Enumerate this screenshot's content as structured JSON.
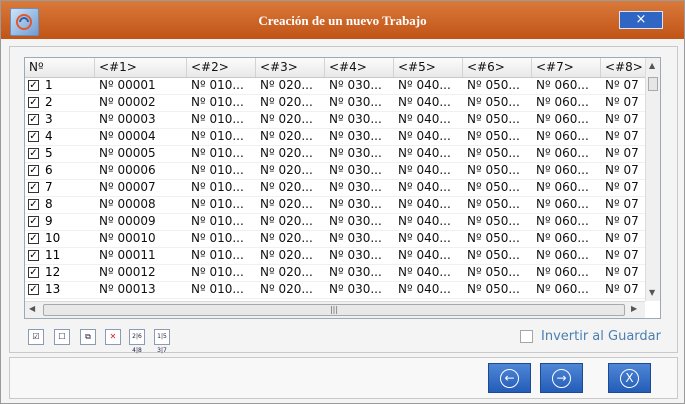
{
  "window": {
    "title": "Creación de un nuevo Trabajo",
    "close_label": "×"
  },
  "grid": {
    "headers": [
      "Nº",
      "<#1>",
      "<#2>",
      "<#3>",
      "<#4>",
      "<#5>",
      "<#6>",
      "<#7>",
      "<#8>"
    ],
    "rows": [
      {
        "n": "1",
        "c": [
          "Nº 00001",
          "Nº 010...",
          "Nº 020...",
          "Nº 030...",
          "Nº 040...",
          "Nº 050...",
          "Nº 060...",
          "Nº 07"
        ]
      },
      {
        "n": "2",
        "c": [
          "Nº 00002",
          "Nº 010...",
          "Nº 020...",
          "Nº 030...",
          "Nº 040...",
          "Nº 050...",
          "Nº 060...",
          "Nº 07"
        ]
      },
      {
        "n": "3",
        "c": [
          "Nº 00003",
          "Nº 010...",
          "Nº 020...",
          "Nº 030...",
          "Nº 040...",
          "Nº 050...",
          "Nº 060...",
          "Nº 07"
        ]
      },
      {
        "n": "4",
        "c": [
          "Nº 00004",
          "Nº 010...",
          "Nº 020...",
          "Nº 030...",
          "Nº 040...",
          "Nº 050...",
          "Nº 060...",
          "Nº 07"
        ]
      },
      {
        "n": "5",
        "c": [
          "Nº 00005",
          "Nº 010...",
          "Nº 020...",
          "Nº 030...",
          "Nº 040...",
          "Nº 050...",
          "Nº 060...",
          "Nº 07"
        ]
      },
      {
        "n": "6",
        "c": [
          "Nº 00006",
          "Nº 010...",
          "Nº 020...",
          "Nº 030...",
          "Nº 040...",
          "Nº 050...",
          "Nº 060...",
          "Nº 07"
        ]
      },
      {
        "n": "7",
        "c": [
          "Nº 00007",
          "Nº 010...",
          "Nº 020...",
          "Nº 030...",
          "Nº 040...",
          "Nº 050...",
          "Nº 060...",
          "Nº 07"
        ]
      },
      {
        "n": "8",
        "c": [
          "Nº 00008",
          "Nº 010...",
          "Nº 020...",
          "Nº 030...",
          "Nº 040...",
          "Nº 050...",
          "Nº 060...",
          "Nº 07"
        ]
      },
      {
        "n": "9",
        "c": [
          "Nº 00009",
          "Nº 010...",
          "Nº 020...",
          "Nº 030...",
          "Nº 040...",
          "Nº 050...",
          "Nº 060...",
          "Nº 07"
        ]
      },
      {
        "n": "10",
        "c": [
          "Nº 00010",
          "Nº 010...",
          "Nº 020...",
          "Nº 030...",
          "Nº 040...",
          "Nº 050...",
          "Nº 060...",
          "Nº 07"
        ]
      },
      {
        "n": "11",
        "c": [
          "Nº 00011",
          "Nº 010...",
          "Nº 020...",
          "Nº 030...",
          "Nº 040...",
          "Nº 050...",
          "Nº 060...",
          "Nº 07"
        ]
      },
      {
        "n": "12",
        "c": [
          "Nº 00012",
          "Nº 010...",
          "Nº 020...",
          "Nº 030...",
          "Nº 040...",
          "Nº 050...",
          "Nº 060...",
          "Nº 07"
        ]
      },
      {
        "n": "13",
        "c": [
          "Nº 00013",
          "Nº 010...",
          "Nº 020...",
          "Nº 030...",
          "Nº 040...",
          "Nº 050...",
          "Nº 060...",
          "Nº 07"
        ]
      }
    ]
  },
  "toolbar": {
    "icons": [
      "check-all-icon",
      "uncheck-all-icon",
      "toggle-check-icon",
      "delete-icon",
      "numbering-icon",
      "sequence-icon"
    ],
    "numbering_text": "2|6 4|8",
    "sequence_text": "1|5 3|7"
  },
  "invert": {
    "label": "Invertir al Guardar",
    "checked": false
  },
  "nav": {
    "back_icon": "arrow-left-icon",
    "next_icon": "arrow-right-icon",
    "cancel_icon": "cancel-x-icon"
  },
  "colors": {
    "title_bar": "#c15417",
    "button_blue": "#235db8"
  }
}
